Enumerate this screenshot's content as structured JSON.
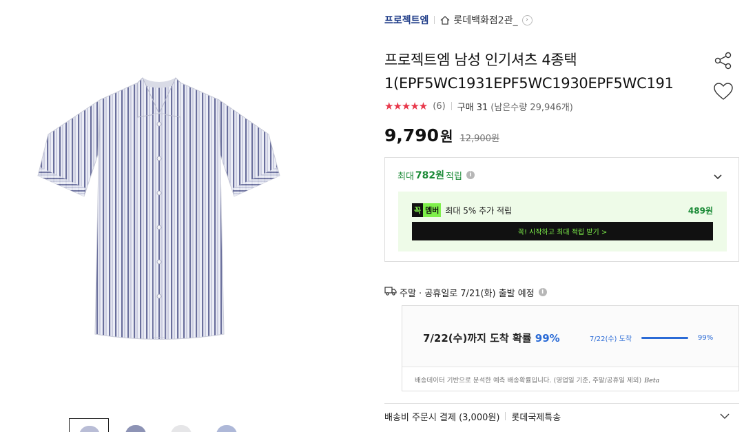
{
  "product": {
    "title": "프로젝트엠 남성 인기셔츠 4종택1(EPF5WC1931EPF5WC1930EPF5WC191",
    "image_alt": "short-sleeve striped shirt",
    "thumbnail_colors": [
      "#b9bdd6",
      "#8d93b5",
      "#e6e6e8",
      "#aeb8d8"
    ]
  },
  "header": {
    "brand": "프로젝트엠",
    "store": "롯데백화점2관_",
    "home_icon": "home-icon",
    "arrow_icon": "chevron-right-icon"
  },
  "actions": {
    "share_icon": "share-icon",
    "wishlist_icon": "heart-icon"
  },
  "rating": {
    "stars": 5,
    "stars_text": "★★★★★",
    "review_count": "(6)",
    "purchase_label": "구매 31",
    "remaining": "(남은수량 29,946개)",
    "star_color": "#e8384b"
  },
  "price": {
    "sale": "9,790",
    "unit": "원",
    "original": "12,900원"
  },
  "points": {
    "prefix": "최대",
    "amount": "782원",
    "suffix": "적립",
    "accent_color": "#1a8a36",
    "member": {
      "logo_a": "꼭",
      "logo_b": "멤버",
      "desc": "최대 5% 추가 적립",
      "amount": "489원",
      "button_label": "꼭! 시작하고 최대 적립 받기 >"
    }
  },
  "shipping": {
    "notice": "주말 · 공휴일로 7/21(화) 출발 예정",
    "eta_text": "7/22(수)까지 도착 확률",
    "eta_pct": "99%",
    "eta_mini_label": "7/22(수) 도착",
    "eta_mini_pct": "99%",
    "eta_probability": 0.99,
    "note": "배송데이터 기반으로 분석한 예측 배송확률입니다. (영업일 기준, 주말/공휴일 제외)",
    "beta": "Beta",
    "fee": "배송비 주문시 결제 (3,000원)",
    "carrier": "롯데국제특송",
    "accent_color": "#2b6bd6"
  }
}
